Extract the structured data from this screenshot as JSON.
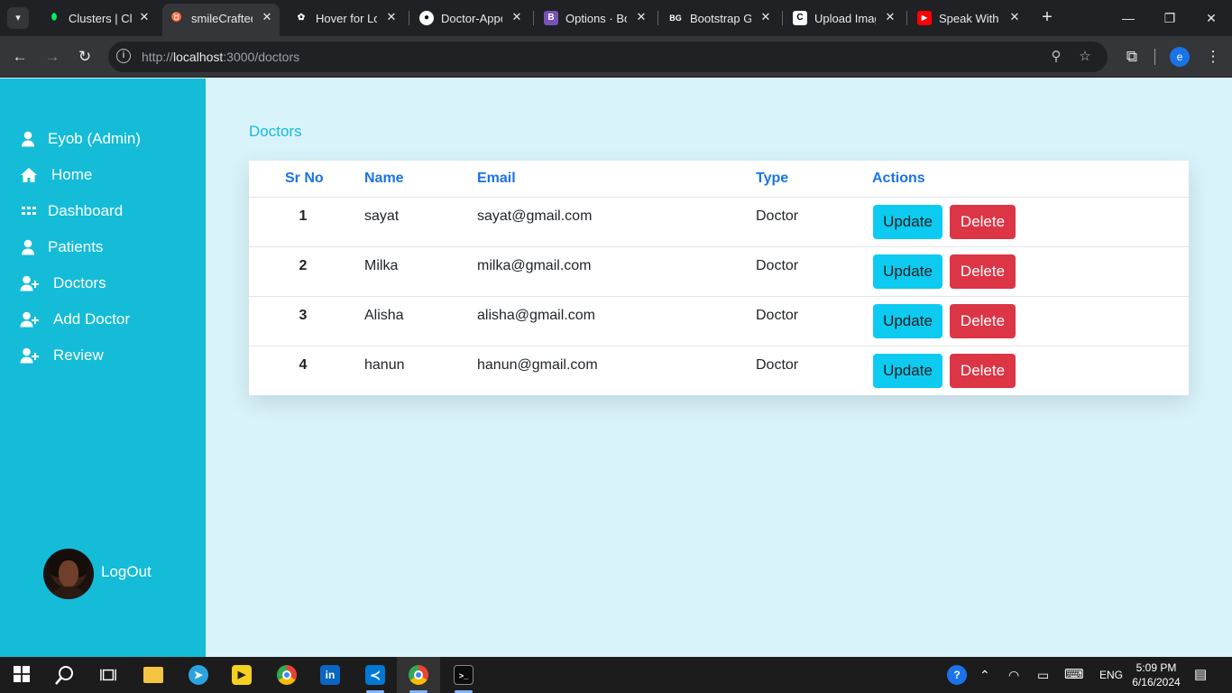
{
  "browser": {
    "tabs": [
      {
        "title": "Clusters | Clo",
        "favicon": "mongodb-leaf-icon",
        "color": "#00ed64",
        "active": false
      },
      {
        "title": "smileCrafted",
        "favicon": "tooth-icon",
        "color": "#ffffff",
        "active": true
      },
      {
        "title": "Hover for Lo",
        "favicon": "openai-icon",
        "color": "#ffffff",
        "active": false
      },
      {
        "title": "Doctor-Appo",
        "favicon": "github-icon",
        "color": "#ffffff",
        "active": false
      },
      {
        "title": "Options · Bo",
        "favicon": "bootstrap-icon",
        "color": "#7952b3",
        "active": false
      },
      {
        "title": "Bootstrap Ga",
        "favicon": "bg-logo-icon",
        "color": "#ffffff",
        "active": false
      },
      {
        "title": "Upload Imag",
        "favicon": "c-logo-icon",
        "color": "#ffffff",
        "active": false
      },
      {
        "title": "Speak With I",
        "favicon": "youtube-icon",
        "color": "#ff0000",
        "active": false
      }
    ],
    "url_scheme": "http://",
    "url_host": "localhost",
    "url_path": ":3000/doctors",
    "profile_initial": "e"
  },
  "sidebar": {
    "items": [
      {
        "label": "Eyob (Admin)",
        "icon": "user-icon"
      },
      {
        "label": "Home",
        "icon": "home-icon"
      },
      {
        "label": "Dashboard",
        "icon": "grid-icon"
      },
      {
        "label": "Patients",
        "icon": "user-icon"
      },
      {
        "label": "Doctors",
        "icon": "user-plus-icon"
      },
      {
        "label": "Add Doctor",
        "icon": "user-plus-icon"
      },
      {
        "label": "Review",
        "icon": "user-plus-icon"
      }
    ],
    "logout_label": "LogOut"
  },
  "main": {
    "title": "Doctors",
    "columns": [
      "Sr No",
      "Name",
      "Email",
      "Type",
      "Actions"
    ],
    "rows": [
      {
        "sr": "1",
        "name": "sayat",
        "email": "sayat@gmail.com",
        "type": "Doctor"
      },
      {
        "sr": "2",
        "name": "Milka",
        "email": "milka@gmail.com",
        "type": "Doctor"
      },
      {
        "sr": "3",
        "name": "Alisha",
        "email": "alisha@gmail.com",
        "type": "Doctor"
      },
      {
        "sr": "4",
        "name": "hanun",
        "email": "hanun@gmail.com",
        "type": "Doctor"
      }
    ],
    "update_label": "Update",
    "delete_label": "Delete"
  },
  "taskbar": {
    "language": "ENG",
    "time": "5:09 PM",
    "date": "6/16/2024"
  },
  "colors": {
    "sidebar": "#14bcd8",
    "background": "#d9f3fb",
    "header_text": "#1a73e8",
    "update": "#0dcaf0",
    "delete": "#dc3545"
  }
}
